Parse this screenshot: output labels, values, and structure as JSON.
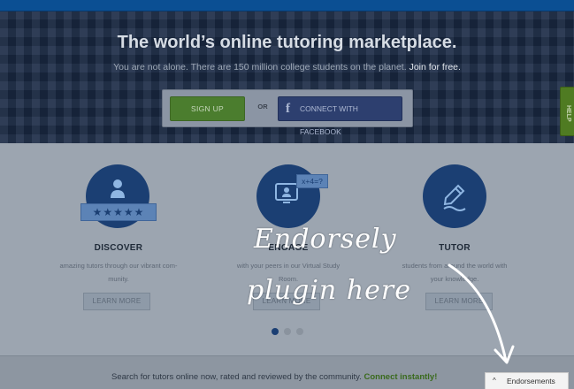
{
  "hero": {
    "title": "The world’s online tutoring marketplace.",
    "subtitle": "You are not alone. There are 150 million college students on the planet.",
    "join_link": "Join for free."
  },
  "cta": {
    "signup_label": "SIGN UP",
    "or_label": "OR",
    "facebook_label": "CONNECT WITH FACEBOOK",
    "facebook_icon": "facebook-f-icon"
  },
  "help_tab": {
    "label": "HELP"
  },
  "features": [
    {
      "title": "DISCOVER",
      "desc_line1": "amazing tutors through our vibrant com-",
      "desc_line2": "munity.",
      "button": "LEARN MORE",
      "icon": "person-rating-icon",
      "stars": "★★★★★"
    },
    {
      "title": "ENGAGE",
      "desc_line1": "with your peers in our Virtual Study",
      "desc_line2": "Room.",
      "button": "LEARN MORE",
      "icon": "virtual-study-icon",
      "equation": "x+4=?"
    },
    {
      "title": "TUTOR",
      "desc_line1": "students from around the world with",
      "desc_line2": "your knowledge.",
      "button": "LEARN MORE",
      "icon": "pencil-writing-icon"
    }
  ],
  "carousel": {
    "pages": 3,
    "active": 1
  },
  "bottom": {
    "text": "Search for tutors online now, rated and reviewed by the community.",
    "connect_link": "Connect instantly!"
  },
  "endorsements_tab": {
    "label": "Endorsements",
    "icon": "chevron-up-icon"
  },
  "annotation": {
    "line1": "Endorsely",
    "line2": "plugin here"
  },
  "colors": {
    "topbar": "#0b4f93",
    "signup": "#4b7d2e",
    "facebook": "#2d3f6f",
    "icon_circle": "#1b3f73",
    "connect_link": "#3a6a1d"
  }
}
